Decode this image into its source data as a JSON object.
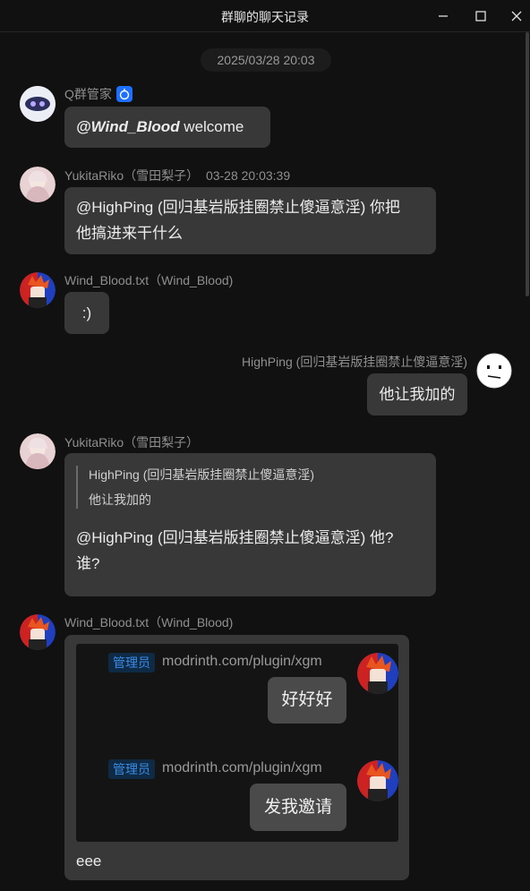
{
  "window": {
    "title": "群聊的聊天记录"
  },
  "date_divider": "2025/03/28 20:03",
  "messages": [
    {
      "sender": "Q群管家",
      "mention": "@Wind_Blood",
      "text": " welcome"
    },
    {
      "sender": "YukitaRiko（雪田梨子）",
      "time": "03-28 20:03:39",
      "line1": "@HighPing (回归基岩版挂圈禁止傻逼意淫) 你把",
      "line2": "他搞进来干什么"
    },
    {
      "sender": "Wind_Blood.txt（Wind_Blood)",
      "text": ":)"
    },
    {
      "sender": "HighPing (回归基岩版挂圈禁止傻逼意淫)",
      "text": "他让我加的"
    },
    {
      "sender": "YukitaRiko（雪田梨子）",
      "quote": {
        "name": "HighPing (回归基岩版挂圈禁止傻逼意淫)",
        "text": "他让我加的"
      },
      "line1": "@HighPing (回归基岩版挂圈禁止傻逼意淫) 他?",
      "line2": "谁?"
    },
    {
      "sender": "Wind_Blood.txt（Wind_Blood)",
      "forwarded": [
        {
          "badge": "管理员",
          "name": "modrinth.com/plugin/xgm",
          "text": "好好好"
        },
        {
          "badge": "管理员",
          "name": "modrinth.com/plugin/xgm",
          "text": "发我邀请"
        }
      ],
      "text": "eee"
    }
  ],
  "colors": {
    "bubble": "#383838",
    "background": "#111111",
    "admin_badge": "#3b8be5",
    "bot_badge": "#1f6fff"
  },
  "icons": [
    "minimize-icon",
    "maximize-icon",
    "close-icon",
    "bot-icon"
  ]
}
